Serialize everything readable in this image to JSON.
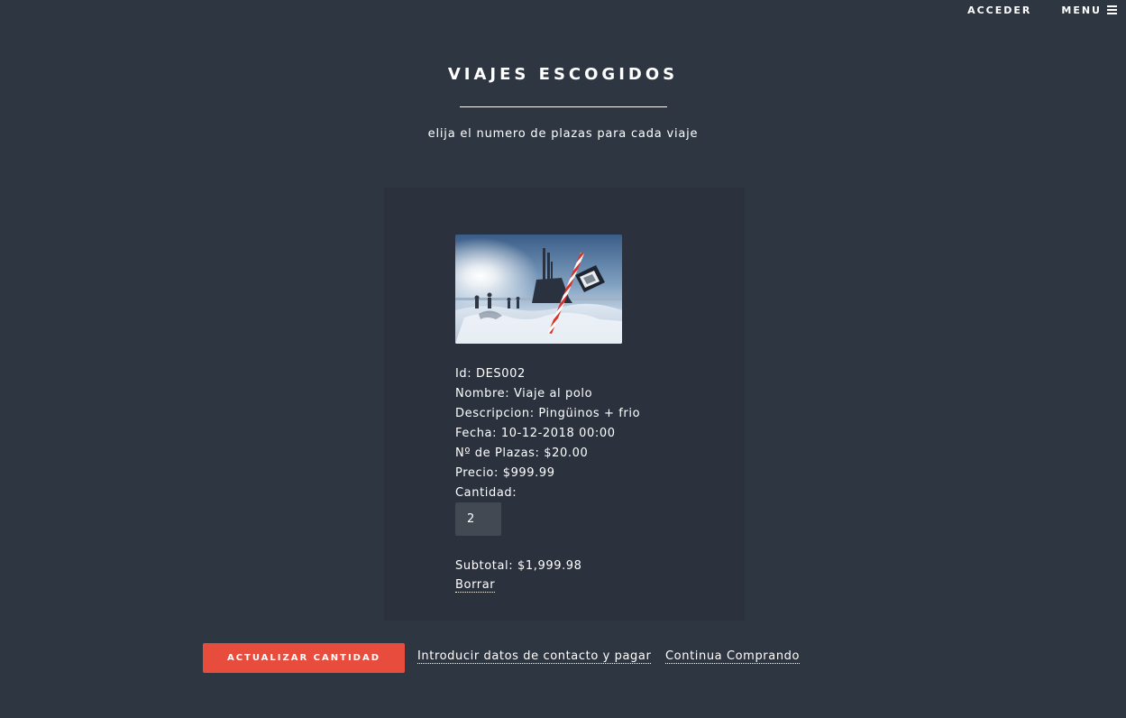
{
  "nav": {
    "login_label": "ACCEDER",
    "menu_label": "MENU",
    "menu_icon": "hamburger-icon"
  },
  "header": {
    "title": "VIAJES ESCOGIDOS",
    "subtitle": "elija el numero de plazas para cada viaje"
  },
  "cart_item": {
    "image_icon": "submarine-north-pole-photo",
    "id_line": "Id: DES002",
    "name_line": "Nombre: Viaje al polo",
    "description_line": "Descripcion: Pingüinos + frio",
    "date_line": "Fecha: 10-12-2018 00:00",
    "seats_line": "Nº de Plazas: $20.00",
    "price_line": "Precio: $999.99",
    "quantity_label": "Cantidad:",
    "quantity_value": "2",
    "subtotal_line": "Subtotal: $1,999.98",
    "delete_label": "Borrar"
  },
  "actions": {
    "update_label": "ACTUALIZAR CANTIDAD",
    "checkout_label": "Introducir datos de contacto y pagar",
    "continue_label": "Continua Comprando"
  },
  "colors": {
    "background": "#2e3642",
    "panel": "#2b323d",
    "accent": "#e84c3d",
    "input": "#424952"
  }
}
